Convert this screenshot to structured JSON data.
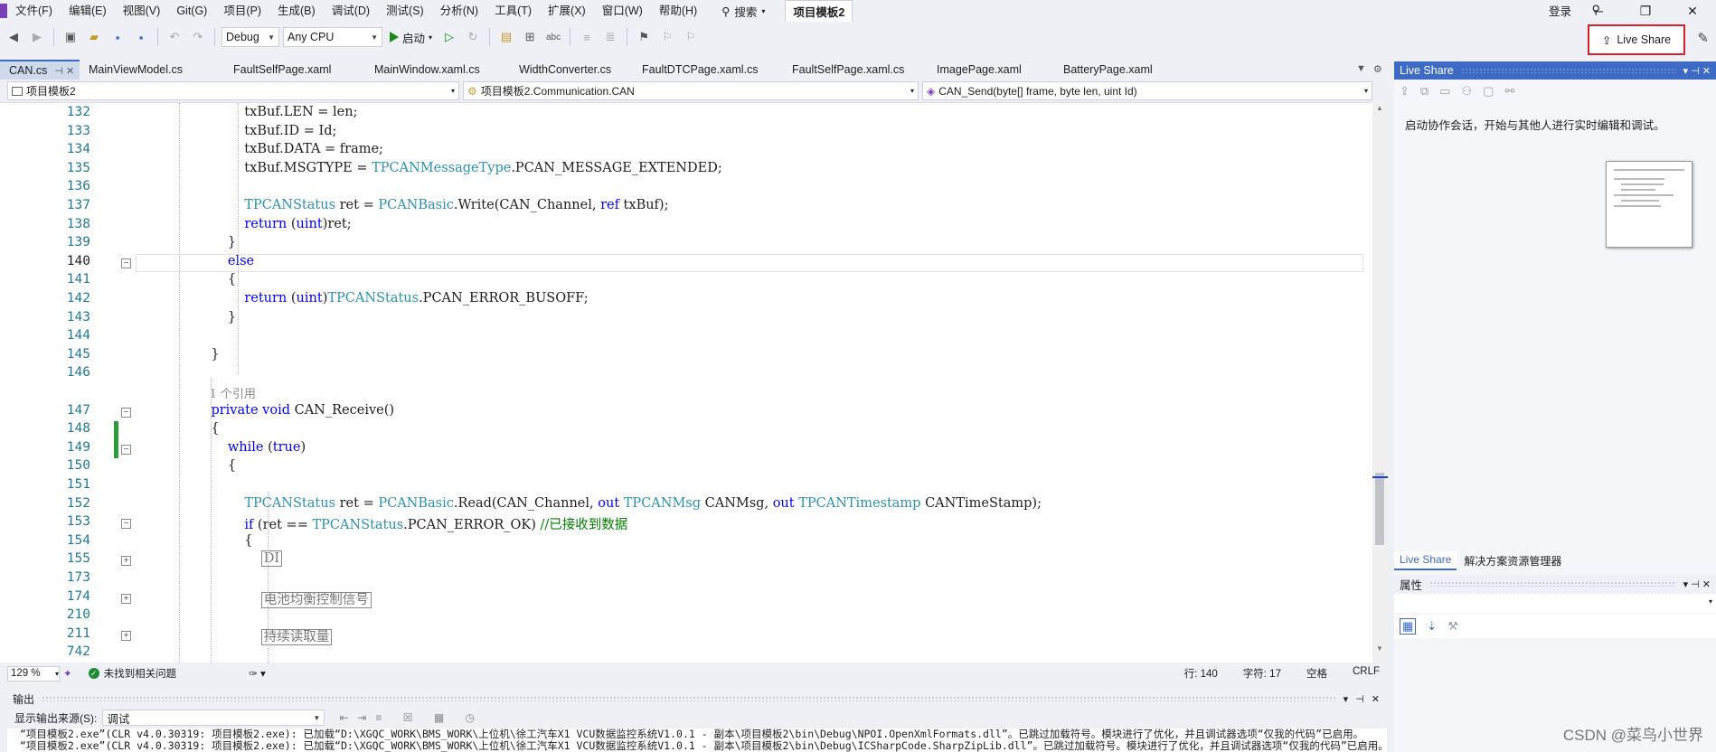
{
  "menu": [
    "文件(F)",
    "编辑(E)",
    "视图(V)",
    "Git(G)",
    "项目(P)",
    "生成(B)",
    "调试(D)",
    "测试(S)",
    "分析(N)",
    "工具(T)",
    "扩展(X)",
    "窗口(W)",
    "帮助(H)"
  ],
  "search_label": "搜索",
  "project_badge": "项目模板2",
  "login": "登录",
  "toolbar": {
    "config": "Debug",
    "platform": "Any CPU",
    "start": "启动"
  },
  "live_share_button": "Live Share",
  "tabs": [
    "CAN.cs",
    "MainViewModel.cs",
    "FaultSelfPage.xaml",
    "MainWindow.xaml.cs",
    "WidthConverter.cs",
    "FaultDTCPage.xaml.cs",
    "FaultSelfPage.xaml.cs",
    "ImagePage.xaml",
    "BatteryPage.xaml"
  ],
  "nav": {
    "project": "项目模板2",
    "class": "项目模板2.Communication.CAN",
    "member": "CAN_Send(byte[] frame, byte len, uint Id)"
  },
  "code_lines": [
    {
      "n": "132",
      "t": "            txBuf.LEN = len;"
    },
    {
      "n": "133",
      "t": "            txBuf.ID = Id;"
    },
    {
      "n": "134",
      "t": "            txBuf.DATA = frame;"
    },
    {
      "n": "135",
      "t": "            txBuf.MSGTYPE = TPCANMessageType.PCAN_MESSAGE_EXTENDED;"
    },
    {
      "n": "136",
      "t": ""
    },
    {
      "n": "137",
      "t": "            TPCANStatus ret = PCANBasic.Write(CAN_Channel, ref txBuf);"
    },
    {
      "n": "138",
      "t": "            return (uint)ret;"
    },
    {
      "n": "139",
      "t": "        }"
    },
    {
      "n": "140",
      "t": "        else"
    },
    {
      "n": "141",
      "t": "        {"
    },
    {
      "n": "142",
      "t": "            return (uint)TPCANStatus.PCAN_ERROR_BUSOFF;"
    },
    {
      "n": "143",
      "t": "        }"
    },
    {
      "n": "144",
      "t": ""
    },
    {
      "n": "145",
      "t": "    }"
    },
    {
      "n": "146",
      "t": ""
    },
    {
      "n": "",
      "t": "    1 个引用"
    },
    {
      "n": "147",
      "t": "    private void CAN_Receive()"
    },
    {
      "n": "148",
      "t": "    {"
    },
    {
      "n": "149",
      "t": "        while (true)"
    },
    {
      "n": "150",
      "t": "        {"
    },
    {
      "n": "151",
      "t": ""
    },
    {
      "n": "152",
      "t": "            TPCANStatus ret = PCANBasic.Read(CAN_Channel, out TPCANMsg CANMsg, out TPCANTimestamp CANTimeStamp);"
    },
    {
      "n": "153",
      "t": "            if (ret == TPCANStatus.PCAN_ERROR_OK) //已接收到数据"
    },
    {
      "n": "154",
      "t": "            {"
    },
    {
      "n": "155",
      "t": "                DI"
    },
    {
      "n": "173",
      "t": ""
    },
    {
      "n": "174",
      "t": "                电池均衡控制信号"
    },
    {
      "n": "210",
      "t": ""
    },
    {
      "n": "211",
      "t": "                持续读取量"
    },
    {
      "n": "742",
      "t": ""
    }
  ],
  "status": {
    "zoom": "129 %",
    "issues": "未找到相关问题",
    "line": "行: 140",
    "col": "字符: 17",
    "spaces": "空格",
    "eol": "CRLF"
  },
  "output": {
    "title": "输出",
    "source_label": "显示输出来源(S):",
    "source_value": "调试",
    "line1": "“项目模板2.exe”(CLR v4.0.30319: 项目模板2.exe): 已加载“D:\\XGQC_WORK\\BMS_WORK\\上位机\\徐工汽车X1 VCU数据监控系统V1.0.1 - 副本\\项目模板2\\bin\\Debug\\NPOI.OpenXmlFormats.dll”。已跳过加载符号。模块进行了优化，并且调试器选项“仅我的代码”已启用。",
    "line2": "“项目模板2.exe”(CLR v4.0.30319: 项目模板2.exe): 已加载“D:\\XGQC_WORK\\BMS_WORK\\上位机\\徐工汽车X1 VCU数据监控系统V1.0.1 - 副本\\项目模板2\\bin\\Debug\\ICSharpCode.SharpZipLib.dll”。已跳过加载符号。模块进行了优化，并且调试器选项“仅我的代码”已启用。"
  },
  "right": {
    "live_share_title": "Live Share",
    "live_share_desc": "启动协作会话，开始与其他人进行实时编辑和调试。",
    "tab1": "Live Share",
    "tab2": "解决方案资源管理器",
    "props_title": "属性"
  },
  "watermark": "CSDN @菜鸟小世界",
  "colors": {
    "keyword": "#0000ff",
    "type": "#2b91af",
    "comment": "#008000",
    "accent": "#3c6ac4",
    "highlight_border": "#d8202b"
  }
}
